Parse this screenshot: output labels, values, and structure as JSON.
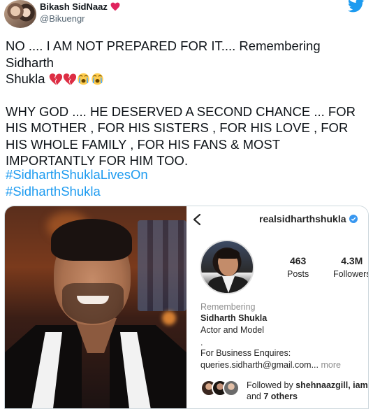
{
  "tweet": {
    "author": {
      "display_name": "Bikash SidNaaz",
      "handle": "@Bikuengr"
    },
    "text": {
      "line1": "NO .... I AM NOT PREPARED FOR IT.... Remembering Sidharth",
      "line2": "Shukla",
      "paragraph2": "WHY GOD .... HE DESERVED A SECOND CHANCE ... FOR HIS MOTHER , FOR HIS SISTERS , FOR HIS LOVE , FOR HIS WHOLE FAMILY , FOR HIS FANS & MOST IMPORTANTLY FOR HIM TOO."
    },
    "emojis": [
      "broken-heart-icon",
      "broken-heart-icon",
      "crying-face-icon",
      "crying-face-icon"
    ],
    "hashtags": [
      "#SidharthShuklaLivesOn",
      "#SidharthShukla"
    ],
    "colors": {
      "link": "#1d9bf0",
      "twitter_brand": "#1d9bf0",
      "heart": "#e0245e"
    }
  },
  "instagram_profile": {
    "username": "realsidharthshukla",
    "stats": {
      "posts_count": "463",
      "posts_label": "Posts",
      "followers_count": "4.3M",
      "followers_label": "Followers"
    },
    "bio": {
      "remembering": "Remembering",
      "full_name": "Sidharth Shukla",
      "category": "Actor and Model",
      "dot": ".",
      "enquiries": "For Business Enquires:",
      "email": "queries.sidharth@gmail.com...",
      "more": " more"
    },
    "followed_by": {
      "prefix": "Followed by ",
      "names": "shehnaazgill, iam",
      "and": "and ",
      "others": "7 others"
    }
  }
}
